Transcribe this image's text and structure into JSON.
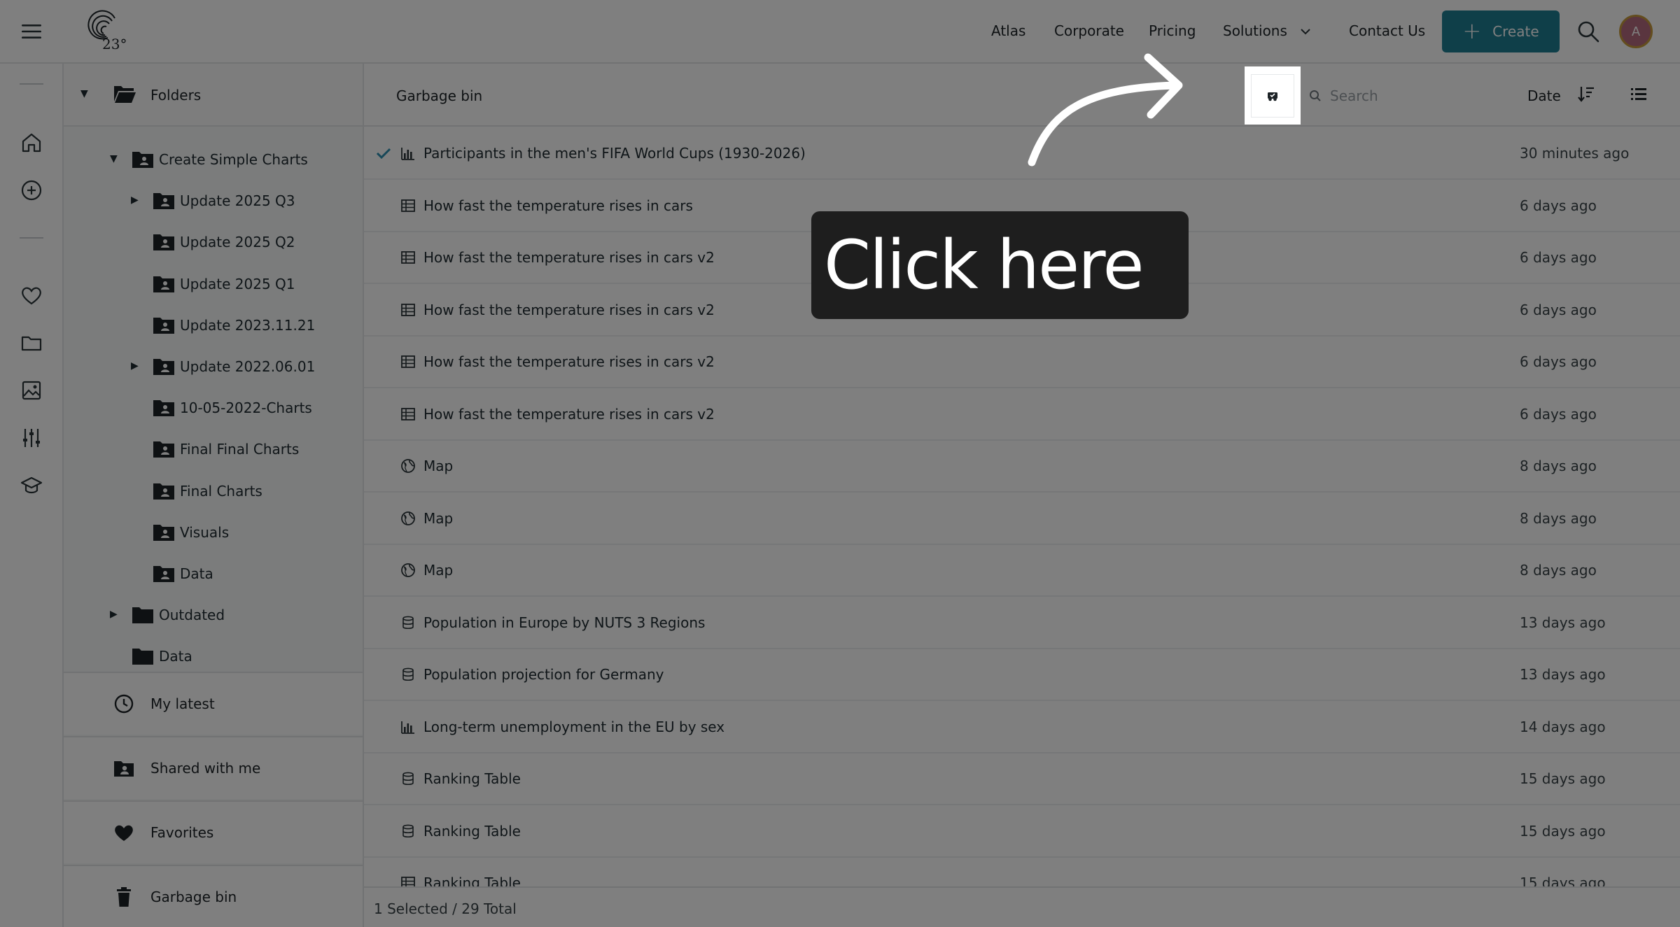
{
  "topbar": {
    "logo_text": "23°",
    "nav": [
      "Atlas",
      "Corporate",
      "Pricing",
      "Solutions",
      "Contact Us"
    ],
    "create_label": "Create",
    "avatar_initial": "A",
    "accent_color": "#1e7e93"
  },
  "tree": {
    "root_label": "Folders",
    "folders": [
      {
        "label": "Create Simple Charts",
        "level": 1,
        "expanded": true
      },
      {
        "label": "Update 2025 Q3",
        "level": 2,
        "collapsed": true
      },
      {
        "label": "Update 2025 Q2",
        "level": 2
      },
      {
        "label": "Update 2025 Q1",
        "level": 2
      },
      {
        "label": "Update 2023.11.21",
        "level": 2
      },
      {
        "label": "Update 2022.06.01",
        "level": 2,
        "collapsed": true
      },
      {
        "label": "10-05-2022-Charts",
        "level": 2
      },
      {
        "label": "Final Final Charts",
        "level": 2
      },
      {
        "label": "Final Charts",
        "level": 2
      },
      {
        "label": "Visuals",
        "level": 2
      },
      {
        "label": "Data",
        "level": 2
      },
      {
        "label": "Outdated",
        "level": 1,
        "collapsed": true
      },
      {
        "label": "Data",
        "level": 1
      }
    ],
    "sections": [
      "My latest",
      "Shared with me",
      "Favorites",
      "Garbage bin"
    ]
  },
  "main": {
    "breadcrumb": "Garbage bin",
    "search_placeholder": "Search",
    "sort_label": "Date",
    "rows": [
      {
        "title": "Participants in the men's FIFA World Cups (1930-2026)",
        "time": "30 minutes ago",
        "icon": "bar-chart-icon",
        "selected": true
      },
      {
        "title": "How fast the temperature rises in cars",
        "time": "6 days ago",
        "icon": "table-icon"
      },
      {
        "title": "How fast the temperature rises in cars v2",
        "time": "6 days ago",
        "icon": "table-icon"
      },
      {
        "title": "How fast the temperature rises in cars v2",
        "time": "6 days ago",
        "icon": "table-icon"
      },
      {
        "title": "How fast the temperature rises in cars v2",
        "time": "6 days ago",
        "icon": "table-icon"
      },
      {
        "title": "How fast the temperature rises in cars v2",
        "time": "6 days ago",
        "icon": "table-icon"
      },
      {
        "title": "Map",
        "time": "8 days ago",
        "icon": "globe-icon"
      },
      {
        "title": "Map",
        "time": "8 days ago",
        "icon": "globe-icon"
      },
      {
        "title": "Map",
        "time": "8 days ago",
        "icon": "globe-icon"
      },
      {
        "title": "Population in Europe by NUTS 3 Regions",
        "time": "13 days ago",
        "icon": "database-icon"
      },
      {
        "title": "Population projection for Germany",
        "time": "13 days ago",
        "icon": "database-icon"
      },
      {
        "title": "Long-term unemployment in the EU by sex",
        "time": "14 days ago",
        "icon": "bar-chart-icon"
      },
      {
        "title": "Ranking Table",
        "time": "15 days ago",
        "icon": "database-icon"
      },
      {
        "title": "Ranking Table",
        "time": "15 days ago",
        "icon": "database-icon"
      },
      {
        "title": "Ranking Table",
        "time": "15 days ago",
        "icon": "table-icon"
      }
    ],
    "footer": "1 Selected / 29 Total"
  },
  "tutorial": {
    "callout_text": "Click here"
  }
}
